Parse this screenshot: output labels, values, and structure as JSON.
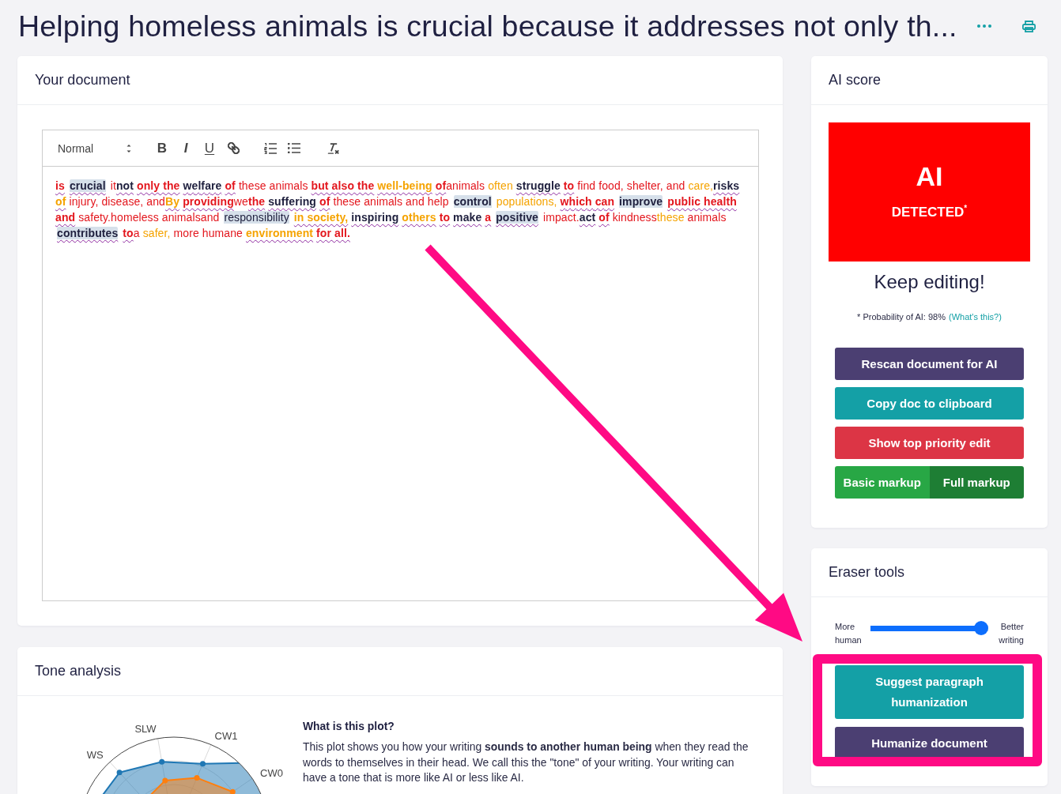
{
  "page": {
    "title": "Helping homeless animals is crucial because it addresses not only th..."
  },
  "document": {
    "title": "Your document",
    "toolbar": {
      "block_format": "Normal",
      "text_buttons": [
        {
          "label": "B",
          "kind": "bold"
        },
        {
          "label": "I",
          "kind": "italic"
        },
        {
          "label": "U",
          "kind": "underline"
        }
      ]
    },
    "segments": [
      {
        "text": "is",
        "color": "#e3161d",
        "bold": true,
        "flagged": true,
        "highlighted": false
      },
      {
        "text": " crucial",
        "color": "#20213f",
        "bold": true,
        "flagged": true,
        "highlighted": true
      },
      {
        "text": " it",
        "color": "#e3161d",
        "bold": false,
        "flagged": false,
        "highlighted": false
      },
      {
        "text": "not",
        "color": "#20213f",
        "bold": true,
        "flagged": true,
        "highlighted": false
      },
      {
        "text": " only the",
        "color": "#e3161d",
        "bold": true,
        "flagged": true,
        "highlighted": false
      },
      {
        "text": " welfare",
        "color": "#20213f",
        "bold": true,
        "flagged": true,
        "highlighted": false
      },
      {
        "text": " of",
        "color": "#e3161d",
        "bold": true,
        "flagged": true,
        "highlighted": false
      },
      {
        "text": " these animals",
        "color": "#e3161d",
        "bold": false,
        "flagged": false,
        "highlighted": false
      },
      {
        "text": " but also the",
        "color": "#e3161d",
        "bold": true,
        "flagged": true,
        "highlighted": false
      },
      {
        "text": " well-being",
        "color": "#f5a300",
        "bold": true,
        "flagged": true,
        "highlighted": false
      },
      {
        "text": " of",
        "color": "#e3161d",
        "bold": true,
        "flagged": true,
        "highlighted": false
      },
      {
        "text": "animals",
        "color": "#e3161d",
        "bold": false,
        "flagged": false,
        "highlighted": false
      },
      {
        "text": " often",
        "color": "#f5a300",
        "bold": false,
        "flagged": false,
        "highlighted": false
      },
      {
        "text": " struggle",
        "color": "#20213f",
        "bold": true,
        "flagged": true,
        "highlighted": false
      },
      {
        "text": " to",
        "color": "#e3161d",
        "bold": true,
        "flagged": true,
        "highlighted": false
      },
      {
        "text": " find food, shelter, and",
        "color": "#e3161d",
        "bold": false,
        "flagged": false,
        "highlighted": false
      },
      {
        "text": " care,",
        "color": "#f5a300",
        "bold": false,
        "flagged": false,
        "highlighted": false
      },
      {
        "text": "risks",
        "color": "#20213f",
        "bold": true,
        "flagged": true,
        "highlighted": false
      },
      {
        "text": " of",
        "color": "#f5a300",
        "bold": true,
        "flagged": true,
        "highlighted": false
      },
      {
        "text": " injury, disease, and",
        "color": "#e3161d",
        "bold": false,
        "flagged": false,
        "highlighted": false
      },
      {
        "text": "By",
        "color": "#f5a300",
        "bold": true,
        "flagged": true,
        "highlighted": false
      },
      {
        "text": " providing",
        "color": "#e3161d",
        "bold": true,
        "flagged": true,
        "highlighted": false
      },
      {
        "text": "we",
        "color": "#e3161d",
        "bold": false,
        "flagged": false,
        "highlighted": false
      },
      {
        "text": "the",
        "color": "#e3161d",
        "bold": true,
        "flagged": true,
        "highlighted": false
      },
      {
        "text": " suffering",
        "color": "#20213f",
        "bold": true,
        "flagged": true,
        "highlighted": false
      },
      {
        "text": " of",
        "color": "#e3161d",
        "bold": true,
        "flagged": true,
        "highlighted": false
      },
      {
        "text": " these animals and help",
        "color": "#e3161d",
        "bold": false,
        "flagged": false,
        "highlighted": false
      },
      {
        "text": " control",
        "color": "#20213f",
        "bold": true,
        "flagged": false,
        "highlighted": true
      },
      {
        "text": " populations,",
        "color": "#f5a300",
        "bold": false,
        "flagged": false,
        "highlighted": false
      },
      {
        "text": " which can",
        "color": "#e3161d",
        "bold": true,
        "flagged": true,
        "highlighted": false
      },
      {
        "text": " improve",
        "color": "#20213f",
        "bold": true,
        "flagged": false,
        "highlighted": true
      },
      {
        "text": " public health",
        "color": "#e3161d",
        "bold": true,
        "flagged": true,
        "highlighted": false
      },
      {
        "text": " and",
        "color": "#e3161d",
        "bold": true,
        "flagged": true,
        "highlighted": false
      },
      {
        "text": " safety.homeless animalsand",
        "color": "#e3161d",
        "bold": false,
        "flagged": false,
        "highlighted": false
      },
      {
        "text": " responsibility",
        "color": "#20213f",
        "bold": false,
        "flagged": false,
        "highlighted": true
      },
      {
        "text": " in society,",
        "color": "#f5a300",
        "bold": true,
        "flagged": true,
        "highlighted": false
      },
      {
        "text": " inspiring",
        "color": "#20213f",
        "bold": true,
        "flagged": true,
        "highlighted": false
      },
      {
        "text": " others",
        "color": "#f5a300",
        "bold": true,
        "flagged": true,
        "highlighted": false
      },
      {
        "text": " to",
        "color": "#e3161d",
        "bold": true,
        "flagged": true,
        "highlighted": false
      },
      {
        "text": " make",
        "color": "#20213f",
        "bold": true,
        "flagged": true,
        "highlighted": false
      },
      {
        "text": " a",
        "color": "#e3161d",
        "bold": true,
        "flagged": true,
        "highlighted": false
      },
      {
        "text": " positive",
        "color": "#20213f",
        "bold": true,
        "flagged": true,
        "highlighted": true
      },
      {
        "text": " impact.",
        "color": "#e3161d",
        "bold": false,
        "flagged": false,
        "highlighted": false
      },
      {
        "text": "act",
        "color": "#20213f",
        "bold": true,
        "flagged": true,
        "highlighted": false
      },
      {
        "text": " of",
        "color": "#e3161d",
        "bold": true,
        "flagged": true,
        "highlighted": false
      },
      {
        "text": " kindness",
        "color": "#e3161d",
        "bold": false,
        "flagged": false,
        "highlighted": false
      },
      {
        "text": "these",
        "color": "#f5a300",
        "bold": false,
        "flagged": false,
        "highlighted": false
      },
      {
        "text": " animals",
        "color": "#e3161d",
        "bold": false,
        "flagged": false,
        "highlighted": false
      },
      {
        "text": " contributes",
        "color": "#20213f",
        "bold": true,
        "flagged": true,
        "highlighted": true
      },
      {
        "text": " to",
        "color": "#e3161d",
        "bold": true,
        "flagged": true,
        "highlighted": false
      },
      {
        "text": "a",
        "color": "#e3161d",
        "bold": false,
        "flagged": false,
        "highlighted": false
      },
      {
        "text": " safer,",
        "color": "#f5a300",
        "bold": false,
        "flagged": false,
        "highlighted": false
      },
      {
        "text": " more humane",
        "color": "#e3161d",
        "bold": false,
        "flagged": false,
        "highlighted": false
      },
      {
        "text": " environment",
        "color": "#f5a300",
        "bold": true,
        "flagged": true,
        "highlighted": false
      },
      {
        "text": " for all.",
        "color": "#e3161d",
        "bold": true,
        "flagged": true,
        "highlighted": false
      }
    ]
  },
  "tone": {
    "title": "Tone analysis",
    "radar_axes": [
      "WS",
      "SLW",
      "CW1",
      "CW0"
    ],
    "explainer_title": "What is this plot?",
    "explainer": "This plot shows you how your writing **sounds to another human being** when they read the words to themselves in their head. We call this the \"tone\" of your writing. Your writing can have a tone that is more like AI or less like AI."
  },
  "ai_score": {
    "title": "AI score",
    "detected": true,
    "verdict_big": "AI",
    "verdict": "DETECTED$^{*}$",
    "message": "Keep editing!",
    "probability_note": "* Probability of AI: 98%",
    "info_link": "(What's this?)",
    "actions": [
      {
        "label": "Rescan document for AI",
        "kind": "primary"
      },
      {
        "label": "Copy doc to clipboard",
        "kind": "info"
      },
      {
        "label": "Show top priority edit",
        "kind": "danger"
      }
    ],
    "markup_modes": [
      {
        "label": "Basic markup",
        "selected": false
      },
      {
        "label": "Full markup",
        "selected": true
      }
    ]
  },
  "eraser": {
    "title": "Eraser tools",
    "slider": {
      "left_label": "More human",
      "right_label": "Better writing",
      "level": 1
    },
    "actions": [
      {
        "label": "Suggest paragraph humanization",
        "kind": "info"
      },
      {
        "label": "Humanize document",
        "kind": "primary"
      }
    ]
  }
}
